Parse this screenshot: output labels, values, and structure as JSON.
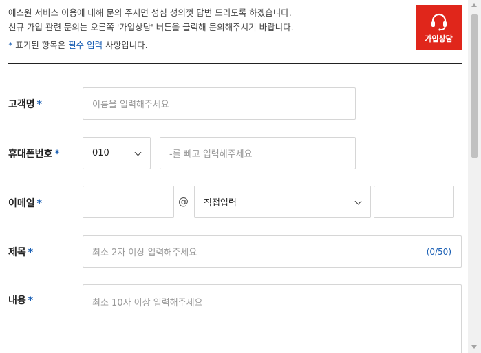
{
  "intro": {
    "line1": "에스원 서비스 이용에 대해 문의 주시면 성심 성의껏 답변 드리도록 하겠습니다.",
    "line2": "신규 가입 관련 문의는 오른쪽 '가입상담' 버튼을 클릭해 문의해주시기 바랍니다."
  },
  "required_note": {
    "star": "*",
    "prefix": " 표기된 항목은 ",
    "emphasis": "필수 입력",
    "suffix": " 사항입니다."
  },
  "consult_button": {
    "label": "가입상담",
    "icon": "headset-icon",
    "color": "#e0261b"
  },
  "form": {
    "required_mark": "*",
    "name": {
      "label": "고객명",
      "placeholder": "이름을 입력해주세요"
    },
    "phone": {
      "label": "휴대폰번호",
      "prefix_value": "010",
      "placeholder": "-를 빼고 입력해주세요"
    },
    "email": {
      "label": "이메일",
      "at": "@",
      "domain_select": "직접입력"
    },
    "subject": {
      "label": "제목",
      "placeholder": "최소 2자 이상 입력해주세요",
      "counter": "(0/50)"
    },
    "content": {
      "label": "내용",
      "placeholder": "최소 10자 이상 입력해주세요"
    }
  },
  "colors": {
    "accent": "#1a5fb4",
    "divider": "#222222"
  }
}
